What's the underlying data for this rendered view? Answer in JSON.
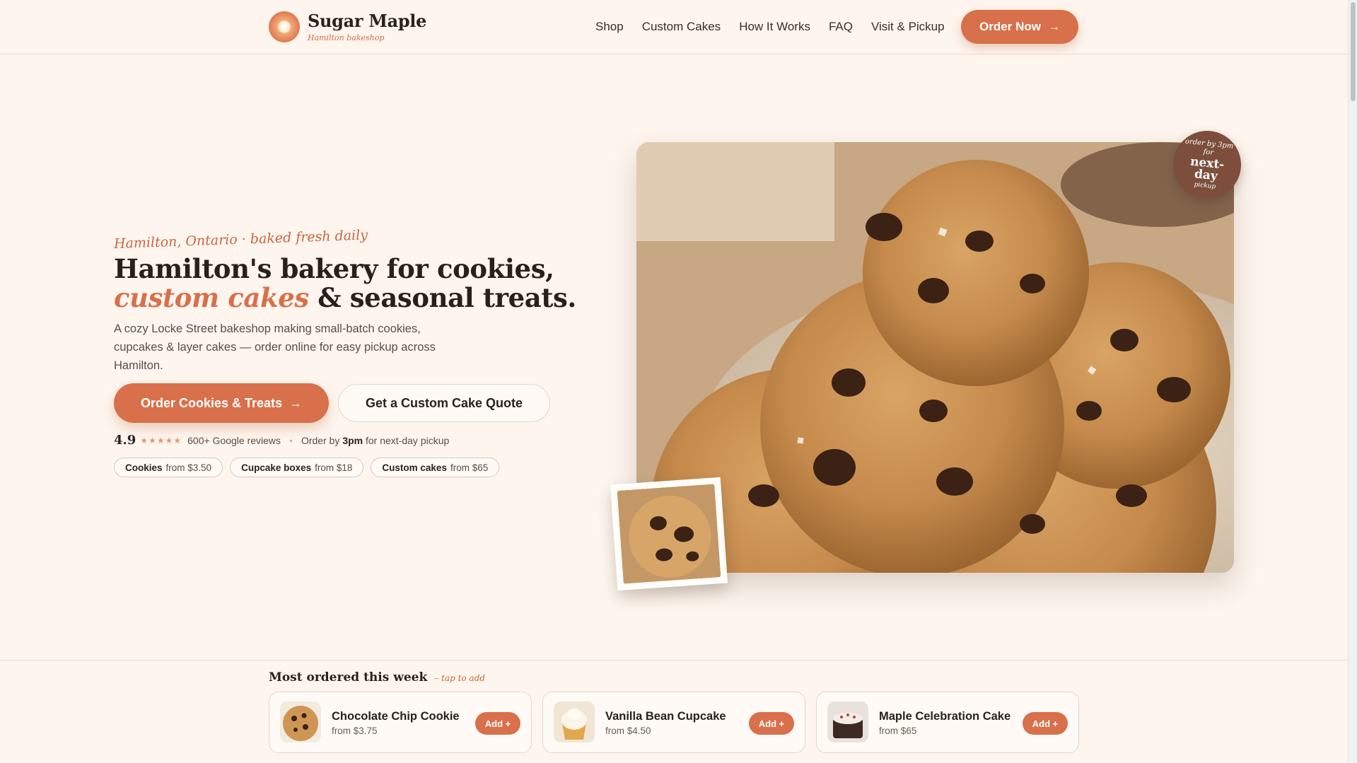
{
  "brand": {
    "name": "Sugar Maple",
    "tagline": "Hamilton bakeshop"
  },
  "nav": {
    "items": [
      {
        "label": "Shop"
      },
      {
        "label": "Custom Cakes"
      },
      {
        "label": "How It Works"
      },
      {
        "label": "FAQ"
      },
      {
        "label": "Visit & Pickup"
      }
    ],
    "cta_label": "Order Now",
    "cta_arrow": "→"
  },
  "hero": {
    "eyebrow": "Hamilton, Ontario · baked fresh daily",
    "headline_line1": "Hamilton's bakery for cookies,",
    "headline_accent": "custom cakes",
    "headline_line2_rest": " & seasonal treats.",
    "lede": "A cozy Locke Street bakeshop making small-batch cookies, cupcakes & layer cakes — order online for easy pickup across Hamilton.",
    "primary_cta": "Order Cookies & Treats",
    "primary_arrow": "→",
    "secondary_cta": "Get a Custom Cake Quote",
    "rating": {
      "score": "4.9",
      "stars": "★★★★★",
      "reviews": "600+ Google reviews",
      "order_prefix": "Order by ",
      "order_time": "3pm",
      "order_suffix": " for next-day pickup"
    },
    "price_pills": [
      {
        "name": "Cookies",
        "price": "from $3.50"
      },
      {
        "name": "Cupcake boxes",
        "price": "from $18"
      },
      {
        "name": "Custom cakes",
        "price": "from $65"
      }
    ],
    "badge": {
      "line1": "order by 3pm",
      "line2": "for",
      "line3": "next-",
      "line4": "day",
      "line5": "pickup"
    }
  },
  "most_ordered": {
    "title": "Most ordered this week",
    "hint": "– tap to add",
    "products": [
      {
        "name": "Chocolate Chip Cookie",
        "price": "from $3.75",
        "add_label": "Add +"
      },
      {
        "name": "Vanilla Bean Cupcake",
        "price": "from $4.50",
        "add_label": "Add +"
      },
      {
        "name": "Maple Celebration Cake",
        "price": "from $65",
        "add_label": "Add +"
      }
    ]
  },
  "colors": {
    "accent": "#d8704b",
    "background": "#fdf5ee",
    "text": "#2b211c",
    "badge": "#7c4e3b"
  },
  "icons": {
    "logo": "sun-logo-icon",
    "arrow": "arrow-right-icon",
    "stars": "star-rating-icon"
  }
}
